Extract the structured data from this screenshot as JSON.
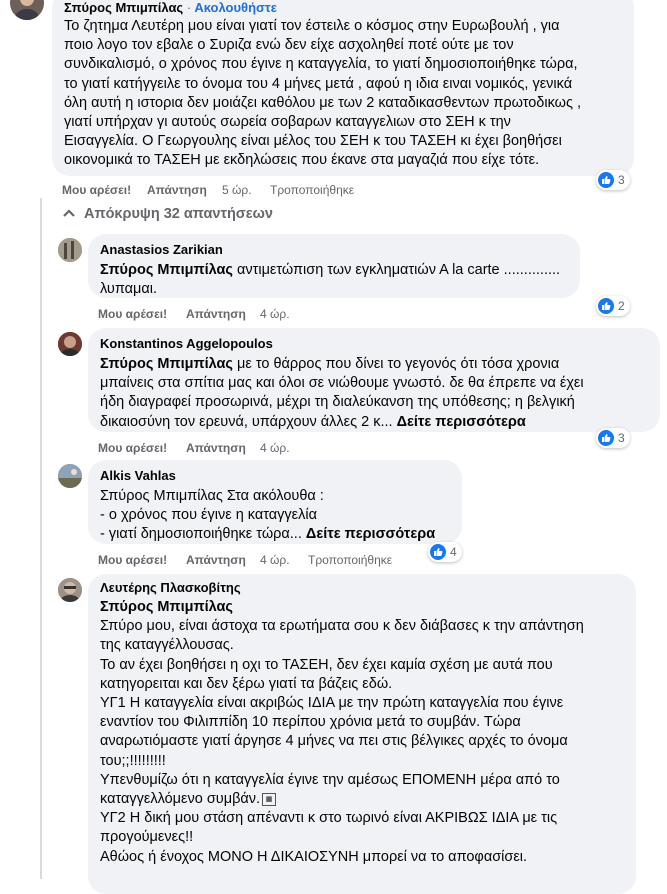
{
  "top_comment": {
    "author": "Σπύρος Μπιμπίλας",
    "separator": "·",
    "follow_label": "Ακολουθήστε",
    "text": "Το ζητημα Λευτέρη μου είναι γιατί τον έστειλε ο κόσμος στην Ευρωβουλή , για\nποιο λογο τον εβαλε ο Συριζα ενώ δεν είχε ασχοληθεί ποτέ ούτε με τον\nσυνδικαλισμό, ο χρόνος που έγινε η καταγγελία, το γιατί δημοσιοποιήθηκε τώρα,\nτο γιατί κατήγγειλε το όνομα του 4 μήνες μετά , αφού η ιδια ειναι νομικός, γενικά\nόλη αυτή η ιστορια δεν μοιάζει καθόλου με των 2 καταδικασθεντων πρωτοδικως ,\nγιατί υπήρχαν γι αυτούς σωρεία σοβαρων καταγγελιων στο ΣΕΗ κ την\nΕισαγγελία. Ο Γεωργουλης είναι μέλος του ΣΕΗ κ του ΤΑΣΕΗ κι έχει βοηθήσει\nοικονομικά το ΤΑΣΕΗ με εκδηλώσεις που έκανε στα μαγαζιά που είχε τότε.",
    "like_label": "Μου αρέσει!",
    "reply_label": "Απάντηση",
    "time": "5 ώρ.",
    "edited_label": "Τροποποιήθηκε",
    "reactions": "3"
  },
  "hide_replies_label": "Απόκρυψη 32 απαντήσεων",
  "replies": [
    {
      "author": "Anastasios Zarikian",
      "mention": "Σπύρος Μπιμπίλας",
      "text": " αντιμετώπιση των εγκληματιών Α la carte ..............\nλυπαμαι.",
      "like_label": "Μου αρέσει!",
      "reply_label": "Απάντηση",
      "time": "4 ώρ.",
      "reactions": "2"
    },
    {
      "author": "Konstantinos Aggelopoulos",
      "mention": "Σπύρος Μπιμπίλας",
      "text": " με το θάρρος που δίνει το γεγονός ότι τόσα χρονια\nμπαίνεις στα σπίτια μας και όλοι σε νιώθουμε γνωστό. δε θα έπρεπε να έχει\nήδη διαγραφεί προσωρινά, μέχρι τη διαλεύκανση της υπόθεσης; η βελγική\nδικαιοσύνη τον ερευνά, υπάρχουν άλλες 2 κ... ",
      "see_more": "Δείτε περισσότερα",
      "like_label": "Μου αρέσει!",
      "reply_label": "Απάντηση",
      "time": "4 ώρ.",
      "reactions": "3"
    },
    {
      "author": "Alkis Vahlas",
      "text": "Σπύρος Μπιμπίλας Στα ακόλουθα :\n- ο χρόνος που έγινε η καταγγελία\n- γιατί δημοσιοποιήθηκε τώρα... ",
      "see_more": "Δείτε περισσότερα",
      "like_label": "Μου αρέσει!",
      "reply_label": "Απάντηση",
      "time": "4 ώρ.",
      "edited_label": "Τροποποιήθηκε",
      "reactions": "4"
    },
    {
      "author": "Λευτέρης Πλασκοβίτης",
      "mention": "Σπύρος Μπιμπίλας",
      "text": "Σπύρο μου, είναι άστοχα τα ερωτήματα σου κ δεν διάβασες κ την απάντηση\nτης καταγγέλλουσας.\nΤο αν έχει βοηθήσει η οχι το ΤΑΣΕΗ, δεν έχει καμία σχέση με αυτά που\nκατηγορειται και δεν ξέρω γιατί τα βάζεις εδώ.\nΥΓ1 Η καταγγελία είναι ακριβώς ΙΔΙΑ με την πρώτη καταγγελία που έγινε\nεναντίον του Φιλιππίδη 10 περίπου χρόνια μετά το συμβάν. Τώρα\nαναρωτιόμαστε γιατί άργησε 4 μήνες να πει στις βέλγικες αρχές το όνομα\nτου;;!!!!!!!!!\nΥπενθυμίζω ότι η καταγγελία έγινε την αμέσως ΕΠΟΜΕΝΗ μέρα από το\nκαταγγελλόμενο συμβάν.",
      "text_end": "ΥΓ2 Η δική μου στάση απέναντι κ στο τωρινό είναι ΑΚΡΙΒΩΣ ΙΔΙΑ με τις\nπρογούμενες!!\nΑθώος ή ένοχος ΜΟΝΟ Η ΔΙΚΑΙΟΣΥΝΗ μπορεί να το αποφασίσει."
    }
  ],
  "colors": {
    "bubble": "#f0f2f5",
    "link": "#216fdb",
    "like_blue": "#1877f2",
    "secondary_text": "#65676b"
  }
}
